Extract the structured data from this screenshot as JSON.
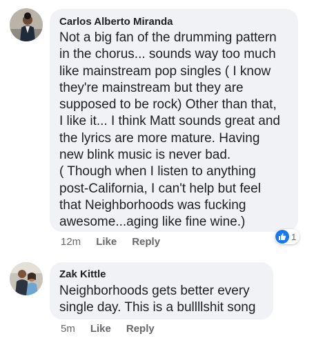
{
  "comments": [
    {
      "author": "Carlos Alberto Miranda",
      "lines": [
        "Not a big fan of the drumming pattern",
        "in the chorus... sounds way too much",
        "like mainstream pop singles ( I know",
        "they're mainstream but they are",
        "supposed to be rock) Other than that,",
        "I like it... I think Matt sounds great and",
        "the lyrics are more mature. Having",
        "new blink music is never bad.",
        "( Though when I listen to anything",
        "post-California, I can't help but feel",
        "that Neighborhoods was fucking",
        "awesome...aging like fine wine.)"
      ],
      "time": "12m",
      "like_label": "Like",
      "reply_label": "Reply",
      "reaction_icon": "like-icon",
      "reaction_count": "1"
    },
    {
      "author": "Zak Kittle",
      "lines": [
        "Neighborhoods gets better every",
        "single day. This is a bullllshit song"
      ],
      "time": "5m",
      "like_label": "Like",
      "reply_label": "Reply"
    }
  ],
  "colors": {
    "bubble": "#f0f2f5",
    "text": "#1c1e21",
    "meta": "#65676b",
    "reaction": "#1877f2"
  }
}
